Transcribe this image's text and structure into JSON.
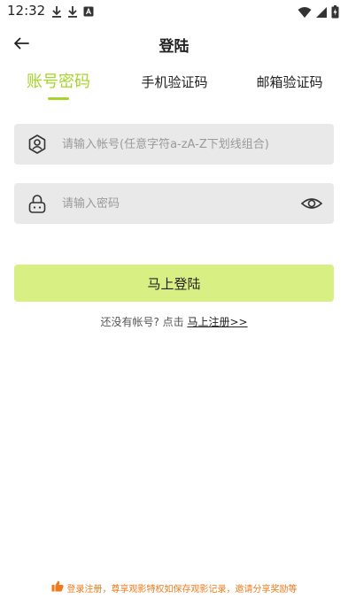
{
  "status_bar": {
    "time": "12:32",
    "left_icons": [
      "download-icon",
      "download-icon",
      "font-icon"
    ],
    "right_icons": [
      "wifi-icon",
      "signal-icon",
      "battery-charging-icon"
    ]
  },
  "header": {
    "title": "登陆",
    "back_icon": "arrow-left-icon"
  },
  "tabs": [
    {
      "label": "账号密码",
      "active": true
    },
    {
      "label": "手机验证码",
      "active": false
    },
    {
      "label": "邮箱验证码",
      "active": false
    }
  ],
  "form": {
    "account": {
      "placeholder": "请输入帐号(任意字符a-zA-Z下划线组合)",
      "value": "",
      "icon": "user-icon"
    },
    "password": {
      "placeholder": "请输入密码",
      "value": "",
      "icon": "lock-icon",
      "toggle_icon": "eye-icon"
    },
    "submit_label": "马上登陆"
  },
  "register": {
    "prompt": "还没有帐号? 点击 ",
    "link_label": "马上注册>>"
  },
  "footer": {
    "note": "登录注册，尊享观影特权如保存观影记录，邀请分享奖励等",
    "icon": "thumbs-up-icon"
  },
  "colors": {
    "accent": "#a6d42a",
    "button": "#d8ef83",
    "field_bg": "#e9e9e9",
    "footer_text": "#f07a1a"
  }
}
